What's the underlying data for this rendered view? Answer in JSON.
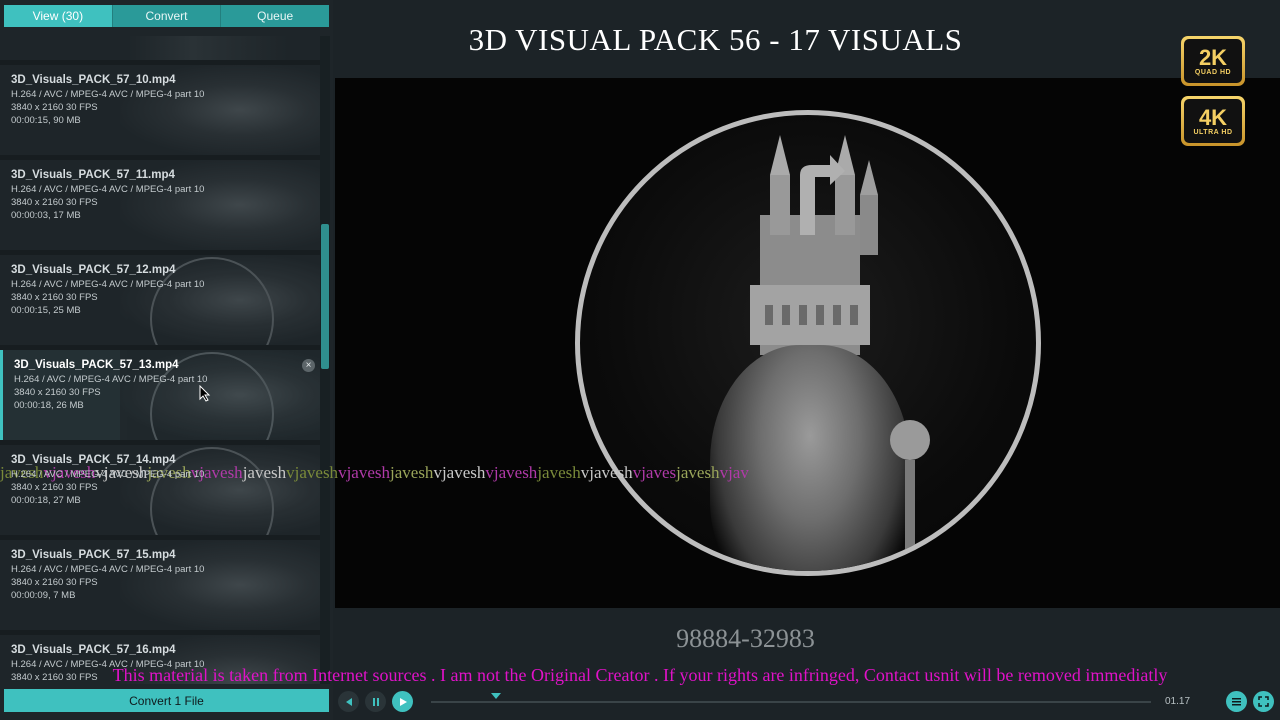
{
  "tabs": [
    {
      "label": "View (30)",
      "active": true
    },
    {
      "label": "Convert",
      "active": false
    },
    {
      "label": "Queue",
      "active": false
    }
  ],
  "files": [
    {
      "name": "3D_Visuals_PACK_57_10.mp4",
      "codec": "H.264 / AVC / MPEG-4 AVC / MPEG-4 part 10",
      "resolution": "3840 x 2160 30 FPS",
      "info": "00:00:15, 90 MB"
    },
    {
      "name": "3D_Visuals_PACK_57_11.mp4",
      "codec": "H.264 / AVC / MPEG-4 AVC / MPEG-4 part 10",
      "resolution": "3840 x 2160 30 FPS",
      "info": "00:00:03, 17 MB"
    },
    {
      "name": "3D_Visuals_PACK_57_12.mp4",
      "codec": "H.264 / AVC / MPEG-4 AVC / MPEG-4 part 10",
      "resolution": "3840 x 2160 30 FPS",
      "info": "00:00:15, 25 MB"
    },
    {
      "name": "3D_Visuals_PACK_57_13.mp4",
      "codec": "H.264 / AVC / MPEG-4 AVC / MPEG-4 part 10",
      "resolution": "3840 x 2160 30 FPS",
      "info": "00:00:18, 26 MB"
    },
    {
      "name": "3D_Visuals_PACK_57_14.mp4",
      "codec": "H.264 / AVC / MPEG-4 AVC / MPEG-4 part 10",
      "resolution": "3840 x 2160 30 FPS",
      "info": "00:00:18, 27 MB"
    },
    {
      "name": "3D_Visuals_PACK_57_15.mp4",
      "codec": "H.264 / AVC / MPEG-4 AVC / MPEG-4 part 10",
      "resolution": "3840 x 2160 30 FPS",
      "info": "00:00:09, 7 MB"
    },
    {
      "name": "3D_Visuals_PACK_57_16.mp4",
      "codec": "H.264 / AVC / MPEG-4 AVC / MPEG-4 part 10",
      "resolution": "3840 x 2160 30 FPS",
      "info": ""
    }
  ],
  "selected_file_index": 3,
  "remove_icon": "×",
  "convert_button": "Convert 1 File",
  "preview": {
    "title": "3D VISUAL PACK 56 - 17 VISUALS",
    "badge_2k": {
      "big": "2K",
      "small": "QUAD HD"
    },
    "badge_4k": {
      "big": "4K",
      "small": "ULTRA HD"
    },
    "phone": "98884-32983",
    "watermark_segments": [
      {
        "text": "javesh",
        "color": "#7a8a3a"
      },
      {
        "text": "vjavesh",
        "color": "#b03aa8"
      },
      {
        "text": "vjavesh",
        "color": "#c8c8c8"
      },
      {
        "text": "javesh",
        "color": "#9aa55a"
      },
      {
        "text": "vjavesh",
        "color": "#b03aa8"
      },
      {
        "text": "javesh",
        "color": "#c8c8c8"
      },
      {
        "text": "vjavesh",
        "color": "#7a8a3a"
      },
      {
        "text": "vjavesh",
        "color": "#b03aa8"
      },
      {
        "text": "javesh",
        "color": "#9aa55a"
      },
      {
        "text": "vjavesh",
        "color": "#c8c8c8"
      },
      {
        "text": "vjavesh",
        "color": "#b03aa8"
      },
      {
        "text": "javesh",
        "color": "#7a8a3a"
      },
      {
        "text": "vjavesh",
        "color": "#c8c8c8"
      },
      {
        "text": "vjaves",
        "color": "#b03aa8"
      },
      {
        "text": "javesh",
        "color": "#9aa55a"
      },
      {
        "text": "vjav",
        "color": "#b03aa8"
      }
    ]
  },
  "playback": {
    "time": "01.17",
    "progress": 0.09
  },
  "disclaimer": "This material is taken from Internet sources . I am not the Original Creator . If your rights are infringed, Contact usnit will be removed immediatly",
  "colors": {
    "accent": "#3fc1bf",
    "tab": "#2a9a99",
    "disclaimer": "#e012c8"
  }
}
